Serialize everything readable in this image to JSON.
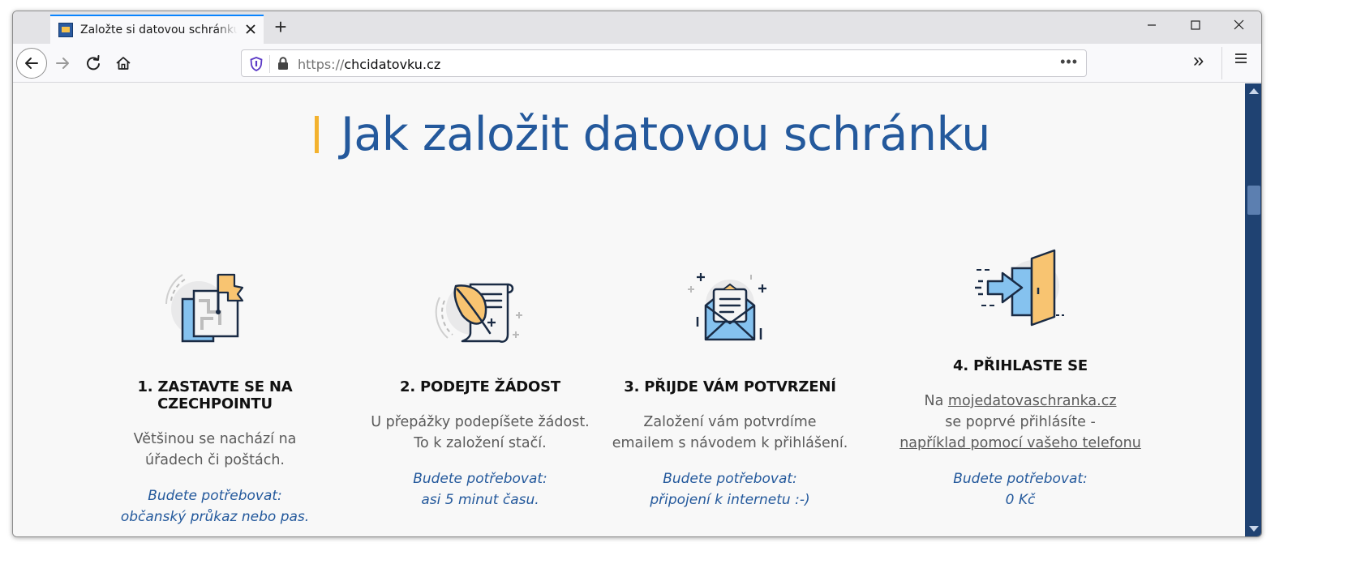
{
  "browser": {
    "tab_title": "Založte si datovou schránku - chcidatovku.cz",
    "new_tab_label": "+",
    "url_protocol": "https://",
    "url_host": "chcidatovku.cz",
    "more_label": "•••",
    "overflow_label": "»",
    "menu_label": "≡"
  },
  "page": {
    "heading": "Jak založit datovou schránku",
    "accent_color": "#f3b22e",
    "heading_color": "#24599c",
    "steps": [
      {
        "icon": "flag-map-icon",
        "title": "1. ZASTAVTE SE NA CZECHPOINTU",
        "text_line1": "Většinou se nachází na",
        "text_line2": "úřadech či poštách.",
        "need_label": "Budete potřebovat:",
        "need_value": "občanský průkaz nebo pas."
      },
      {
        "icon": "quill-scroll-icon",
        "title": "2. PODEJTE ŽÁDOST",
        "text_line1": "U přepážky podepíšete žádost.",
        "text_line2": "To k založení stačí.",
        "need_label": "Budete potřebovat:",
        "need_value": "asi 5 minut času."
      },
      {
        "icon": "envelope-letter-icon",
        "title": "3. PŘIJDE VÁM POTVRZENÍ",
        "text_line1": "Založení vám potvrdíme",
        "text_line2": "emailem s návodem k přihlášení.",
        "need_label": "Budete potřebovat:",
        "need_value": "připojení k internetu :-)"
      },
      {
        "icon": "door-login-icon",
        "title": "4. PŘIHLASTE SE",
        "text_prefix": "Na",
        "text_link": "mojedatovaschranka.cz",
        "text_line2": "se poprvé přihlásíte -",
        "text_link2": "například pomocí vašeho telefonu",
        "need_label": "Budete potřebovat:",
        "need_value": "0 Kč"
      }
    ]
  }
}
